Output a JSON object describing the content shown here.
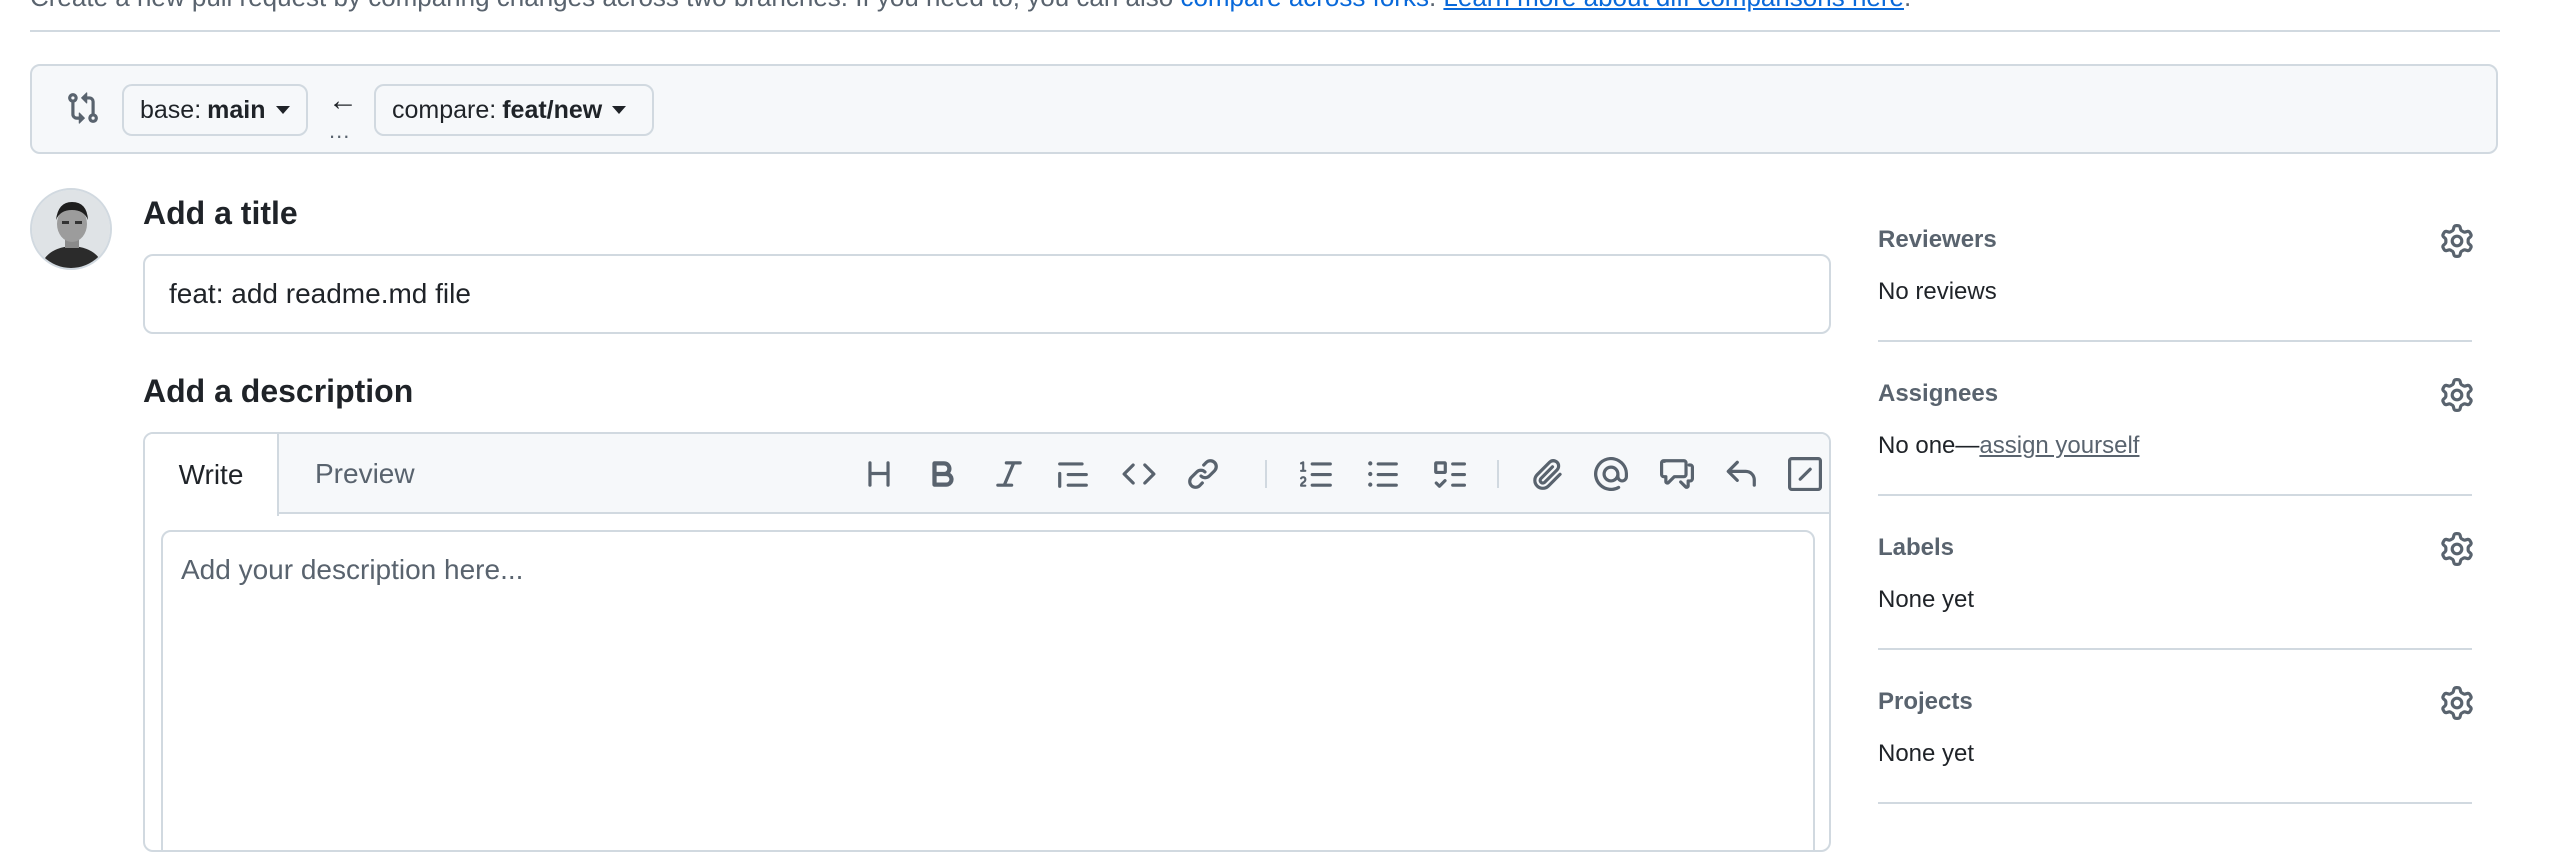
{
  "intro": {
    "text_before": "Create a new pull request by comparing changes across two branches. If you need to, you can also ",
    "link_compare_forks": "compare across forks",
    "text_between": ". ",
    "link_learn_more": "Learn more about diff comparisons here",
    "text_after": "."
  },
  "range": {
    "base_key": "base:",
    "base_value": "main",
    "compare_key": "compare:",
    "compare_value": "feat/new",
    "arrow": "←",
    "dots": "..."
  },
  "title_section": {
    "heading": "Add a title",
    "value": "feat: add readme.md file"
  },
  "description_section": {
    "heading": "Add a description",
    "tabs": [
      "Write",
      "Preview"
    ],
    "active_tab": "Write",
    "placeholder": "Add your description here..."
  },
  "toolbar": {
    "icons": [
      "heading-icon",
      "bold-icon",
      "italic-icon",
      "quote-icon",
      "code-icon",
      "link-icon",
      "numbered-list-icon",
      "unordered-list-icon",
      "task-list-icon",
      "attach-icon",
      "mention-icon",
      "cross-reference-icon",
      "reply-icon",
      "slash-command-icon"
    ]
  },
  "sidebar": {
    "reviewers": {
      "label": "Reviewers",
      "value": "No reviews"
    },
    "assignees": {
      "label": "Assignees",
      "value_prefix": "No one—",
      "link": "assign yourself"
    },
    "labels": {
      "label": "Labels",
      "value": "None yet"
    },
    "projects": {
      "label": "Projects",
      "value": "None yet"
    }
  }
}
